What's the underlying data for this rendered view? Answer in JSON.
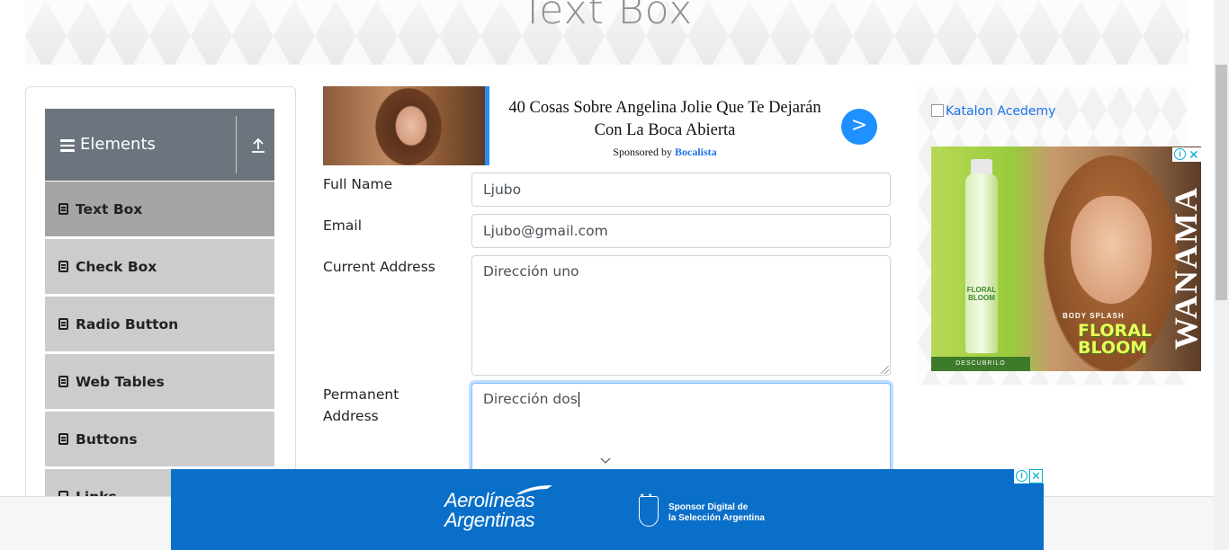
{
  "header": {
    "title": "Text Box"
  },
  "sidebar": {
    "group_title": "Elements",
    "items": [
      {
        "label": "Text Box"
      },
      {
        "label": "Check Box"
      },
      {
        "label": "Radio Button"
      },
      {
        "label": "Web Tables"
      },
      {
        "label": "Buttons"
      },
      {
        "label": "Links"
      }
    ]
  },
  "top_ad": {
    "headline": "40 Cosas Sobre Angelina Jolie Que Te Dejarán Con La Boca Abierta",
    "sponsor_prefix": "Sponsored by ",
    "sponsor_brand": "Bocalista",
    "go_label": ">"
  },
  "form": {
    "full_name": {
      "label": "Full Name",
      "value": "Ljubo"
    },
    "email": {
      "label": "Email",
      "value": "Ljubo@gmail.com"
    },
    "current_address": {
      "label": "Current Address",
      "value": "Dirección uno"
    },
    "permanent_address": {
      "label": "Permanent Address",
      "value": "Dirección dos"
    }
  },
  "right_ad": {
    "link_text": "Katalon Acedemy",
    "product_label": "FLORAL BLOOM",
    "body_splash": "BODY SPLASH",
    "cta": "DESCUBRILO",
    "brand": "WANAMA"
  },
  "bottom_ad": {
    "airline_line1": "Aerolíneas",
    "airline_line2": "Argentinas",
    "sponsor_line1": "Sponsor Digital de",
    "sponsor_line2": "la Selección Argentina"
  },
  "icons": {
    "menu": "hamburger-icon",
    "upload": "upload-icon",
    "doc": "document-icon",
    "chevron": "chevron-down-icon",
    "ad_info": "info-icon",
    "ad_close": "close-icon"
  }
}
